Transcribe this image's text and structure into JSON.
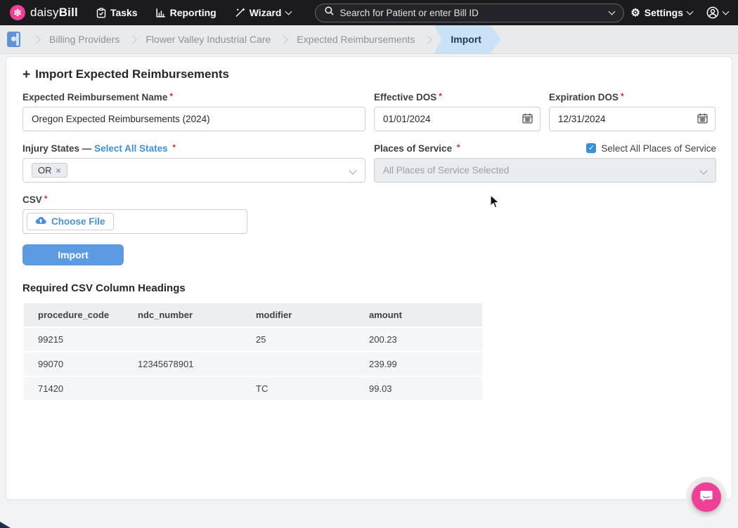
{
  "misc": {
    "required_mark": "*",
    "plus_icon": "+",
    "check_icon": "✓",
    "close_icon": "×",
    "gear_icon": "⚙",
    "flower_icon": "✽",
    "em_dash": "—"
  },
  "nav": {
    "brand_daisy": "daisy",
    "brand_bill": "Bill",
    "tasks_label": "Tasks",
    "reporting_label": "Reporting",
    "wizard_label": "Wizard",
    "search_placeholder": "Search for Patient or enter Bill ID",
    "settings_label": "Settings"
  },
  "breadcrumb": {
    "items": [
      {
        "label": "Billing Providers"
      },
      {
        "label": "Flower Valley Industrial Care"
      },
      {
        "label": "Expected Reimbursements"
      }
    ],
    "active": "Import"
  },
  "form": {
    "title": "Import Expected Reimbursements",
    "name_field": {
      "label": "Expected Reimbursement Name",
      "value": "Oregon Expected Reimbursements (2024)"
    },
    "effective_dos": {
      "label": "Effective DOS",
      "value": "01/01/2024"
    },
    "expiration_dos": {
      "label": "Expiration DOS",
      "value": "12/31/2024"
    },
    "injury_states": {
      "label": "Injury States",
      "link_label": "Select All States",
      "selected_tag": "OR"
    },
    "places_of_service": {
      "label": "Places of Service",
      "checkbox_label": "Select All Places of Service",
      "value": "All Places of Service Selected",
      "checkbox_checked": true
    },
    "csv_field": {
      "label": "CSV",
      "choose_file_label": "Choose File"
    },
    "import_button_label": "Import"
  },
  "csv_table": {
    "title": "Required CSV Column Headings",
    "headers": [
      "procedure_code",
      "ndc_number",
      "modifier",
      "amount"
    ],
    "rows": [
      [
        "99215",
        "",
        "25",
        "200.23"
      ],
      [
        "99070",
        "12345678901",
        "",
        "239.99"
      ],
      [
        "71420",
        "",
        "TC",
        "99.03"
      ]
    ]
  },
  "colors": {
    "brand_pink": "#ee4097",
    "nav_bg": "#1b1b1d",
    "link_blue": "#3f8fd8",
    "import_button_blue": "#5b9be2",
    "breadcrumb_active_bg": "#c9e2f6",
    "required_red": "#c9302c"
  }
}
